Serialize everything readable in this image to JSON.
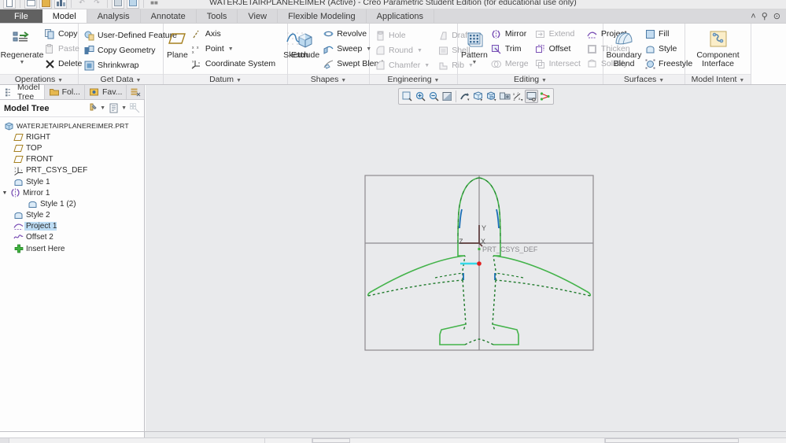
{
  "window": {
    "title": "WATERJETAIRPLANEREIMER (Active) - Creo Parametric Student Edition (for educational use only)",
    "controls": [
      {
        "name": "collapse-ribbon",
        "glyph": "˄"
      },
      {
        "name": "search",
        "glyph": "⚲"
      },
      {
        "name": "help",
        "glyph": "⊙"
      }
    ],
    "quick_access": [
      "new",
      "open",
      "save",
      "undo",
      "redo",
      "regenerate",
      "window",
      "close"
    ]
  },
  "tabs": [
    {
      "id": "file",
      "label": "File",
      "active": false
    },
    {
      "id": "model",
      "label": "Model",
      "active": true
    },
    {
      "id": "analysis",
      "label": "Analysis",
      "active": false
    },
    {
      "id": "annotate",
      "label": "Annotate",
      "active": false
    },
    {
      "id": "tools",
      "label": "Tools",
      "active": false
    },
    {
      "id": "view",
      "label": "View",
      "active": false
    },
    {
      "id": "flexible-modeling",
      "label": "Flexible Modeling",
      "active": false
    },
    {
      "id": "applications",
      "label": "Applications",
      "active": false
    }
  ],
  "ribbon": {
    "groups": [
      {
        "id": "operations",
        "title": "Operations",
        "big": {
          "label": "Regenerate",
          "icon": "regenerate-icon",
          "has_caret": true
        },
        "items": [
          {
            "label": "Copy",
            "icon": "copy-icon",
            "disabled": false,
            "caret": false
          },
          {
            "label": "Paste",
            "icon": "paste-icon",
            "disabled": true,
            "caret": true
          },
          {
            "label": "Delete",
            "icon": "delete-icon",
            "disabled": false,
            "caret": true
          }
        ]
      },
      {
        "id": "get-data",
        "title": "Get Data",
        "items": [
          {
            "label": "User-Defined Feature",
            "icon": "udf-icon",
            "disabled": false,
            "caret": false
          },
          {
            "label": "Copy Geometry",
            "icon": "copy-geometry-icon",
            "disabled": false,
            "caret": false
          },
          {
            "label": "Shrinkwrap",
            "icon": "shrinkwrap-icon",
            "disabled": false,
            "caret": false
          }
        ]
      },
      {
        "id": "datum",
        "title": "Datum",
        "big": {
          "label": "Plane",
          "icon": "plane-icon",
          "has_caret": false
        },
        "items": [
          {
            "label": "Axis",
            "icon": "axis-icon",
            "disabled": false,
            "caret": false
          },
          {
            "label": "Point",
            "icon": "point-icon",
            "disabled": false,
            "caret": true
          },
          {
            "label": "Coordinate System",
            "icon": "csys-icon",
            "disabled": false,
            "caret": false
          }
        ],
        "big2": {
          "label": "Sketch",
          "icon": "sketch-icon",
          "has_caret": false
        }
      },
      {
        "id": "shapes",
        "title": "Shapes",
        "big": {
          "label": "Extrude",
          "icon": "extrude-icon",
          "has_caret": false
        },
        "items": [
          {
            "label": "Revolve",
            "icon": "revolve-icon",
            "disabled": false,
            "caret": false
          },
          {
            "label": "Sweep",
            "icon": "sweep-icon",
            "disabled": false,
            "caret": true
          },
          {
            "label": "Swept Blend",
            "icon": "swept-blend-icon",
            "disabled": false,
            "caret": false
          }
        ]
      },
      {
        "id": "engineering",
        "title": "Engineering",
        "items": [
          {
            "label": "Hole",
            "icon": "hole-icon",
            "disabled": true,
            "caret": false
          },
          {
            "label": "Round",
            "icon": "round-icon",
            "disabled": true,
            "caret": true
          },
          {
            "label": "Chamfer",
            "icon": "chamfer-icon",
            "disabled": true,
            "caret": true
          }
        ],
        "items2": [
          {
            "label": "Draft",
            "icon": "draft-icon",
            "disabled": true,
            "caret": true
          },
          {
            "label": "Shell",
            "icon": "shell-icon",
            "disabled": true,
            "caret": false
          },
          {
            "label": "Rib",
            "icon": "rib-icon",
            "disabled": true,
            "caret": true
          }
        ]
      },
      {
        "id": "editing",
        "title": "Editing",
        "big": {
          "label": "Pattern",
          "icon": "pattern-icon",
          "has_caret": true
        },
        "items": [
          {
            "label": "Mirror",
            "icon": "mirror-icon",
            "disabled": false,
            "caret": false
          },
          {
            "label": "Trim",
            "icon": "trim-icon",
            "disabled": false,
            "caret": false
          },
          {
            "label": "Merge",
            "icon": "merge-icon",
            "disabled": true,
            "caret": false
          }
        ],
        "items2": [
          {
            "label": "Extend",
            "icon": "extend-icon",
            "disabled": true,
            "caret": false
          },
          {
            "label": "Offset",
            "icon": "offset-icon",
            "disabled": false,
            "caret": false
          },
          {
            "label": "Intersect",
            "icon": "intersect-icon",
            "disabled": true,
            "caret": false
          }
        ],
        "items3": [
          {
            "label": "Project",
            "icon": "project-icon",
            "disabled": false,
            "caret": false
          },
          {
            "label": "Thicken",
            "icon": "thicken-icon",
            "disabled": true,
            "caret": false
          },
          {
            "label": "Solidify",
            "icon": "solidify-icon",
            "disabled": true,
            "caret": false
          }
        ]
      },
      {
        "id": "surfaces",
        "title": "Surfaces",
        "big": {
          "label": "Boundary Blend",
          "icon": "boundary-blend-icon",
          "has_caret": false
        },
        "items": [
          {
            "label": "Fill",
            "icon": "fill-icon",
            "disabled": false,
            "caret": false
          },
          {
            "label": "Style",
            "icon": "style-icon",
            "disabled": false,
            "caret": false
          },
          {
            "label": "Freestyle",
            "icon": "freestyle-icon",
            "disabled": false,
            "caret": false
          }
        ]
      },
      {
        "id": "model-intent",
        "title": "Model Intent",
        "big": {
          "label": "Component Interface",
          "icon": "component-interface-icon",
          "has_caret": false
        }
      }
    ]
  },
  "left_panel": {
    "tabs": [
      {
        "id": "model-tree",
        "label": "Model Tree",
        "icon": "model-tree-icon",
        "active": true
      },
      {
        "id": "folder-browser",
        "label": "Fol...",
        "icon": "folder-icon",
        "active": false
      },
      {
        "id": "favorites",
        "label": "Fav...",
        "icon": "favorites-icon",
        "active": false
      },
      {
        "id": "layers",
        "label": "",
        "icon": "layers-icon",
        "active": false
      }
    ],
    "header": {
      "title": "Model Tree",
      "tools": [
        {
          "name": "tree-filters-icon",
          "caret": true
        },
        {
          "name": "tree-settings-icon",
          "caret": true
        },
        {
          "name": "tree-columns-icon",
          "caret": false
        }
      ]
    },
    "tree": [
      {
        "label": "WATERJETAIRPLANEREIMER.PRT",
        "icon": "part-icon",
        "indent": 0,
        "expander": "",
        "selected": false
      },
      {
        "label": "RIGHT",
        "icon": "datum-plane-icon",
        "indent": 1,
        "expander": "",
        "selected": false
      },
      {
        "label": "TOP",
        "icon": "datum-plane-icon",
        "indent": 1,
        "expander": "",
        "selected": false
      },
      {
        "label": "FRONT",
        "icon": "datum-plane-icon",
        "indent": 1,
        "expander": "",
        "selected": false
      },
      {
        "label": "PRT_CSYS_DEF",
        "icon": "csys-icon",
        "indent": 1,
        "expander": "",
        "selected": false
      },
      {
        "label": "Style 1",
        "icon": "style-feature-icon",
        "indent": 1,
        "expander": "",
        "selected": false
      },
      {
        "label": "Mirror 1",
        "icon": "mirror-feature-icon",
        "indent": 1,
        "expander": "▼",
        "selected": false
      },
      {
        "label": "Style 1 (2)",
        "icon": "style-feature-icon",
        "indent": 2,
        "expander": "",
        "selected": false
      },
      {
        "label": "Style 2",
        "icon": "style-feature-icon",
        "indent": 1,
        "expander": "",
        "selected": false
      },
      {
        "label": "Project 1",
        "icon": "project-feature-icon",
        "indent": 1,
        "expander": "",
        "selected": true
      },
      {
        "label": "Offset 2",
        "icon": "offset-feature-icon",
        "indent": 1,
        "expander": "",
        "selected": false
      },
      {
        "label": "Insert Here",
        "icon": "insert-here-icon",
        "indent": 1,
        "expander": "",
        "selected": false
      }
    ]
  },
  "graphics_toolbar": {
    "buttons": [
      {
        "name": "refit-icon",
        "framed": false
      },
      {
        "name": "zoom-in-icon",
        "framed": false
      },
      {
        "name": "zoom-out-icon",
        "framed": false
      },
      {
        "name": "repaint-icon",
        "framed": false
      },
      {
        "name": "spin-center-icon",
        "framed": false
      },
      {
        "name": "display-style-icon",
        "framed": false
      },
      {
        "name": "saved-orientations-icon",
        "framed": false
      },
      {
        "name": "scene-icon",
        "framed": false
      },
      {
        "name": "datum-display-filters-icon",
        "framed": false
      },
      {
        "name": "annotation-display-icon",
        "framed": true
      },
      {
        "name": "spin-center-toggle-icon",
        "framed": false
      }
    ]
  },
  "viewport": {
    "colors": {
      "background": "#e9eaec",
      "datum_plane_border": "#8d8a8e",
      "curve_green": "#43b34a",
      "curve_dark_green": "#1f7a2b",
      "curve_blue": "#1a6fb5",
      "csys_axis": "#5c3b3b",
      "highlight_cyan": "#36d8e8",
      "point_red": "#e02020",
      "label_gray": "#8a8a8e"
    },
    "csys_labels": {
      "x": "X",
      "y": "Y",
      "z": "Z",
      "name": "PRT_CSYS_DEF"
    },
    "model": "airplane-top-view"
  }
}
